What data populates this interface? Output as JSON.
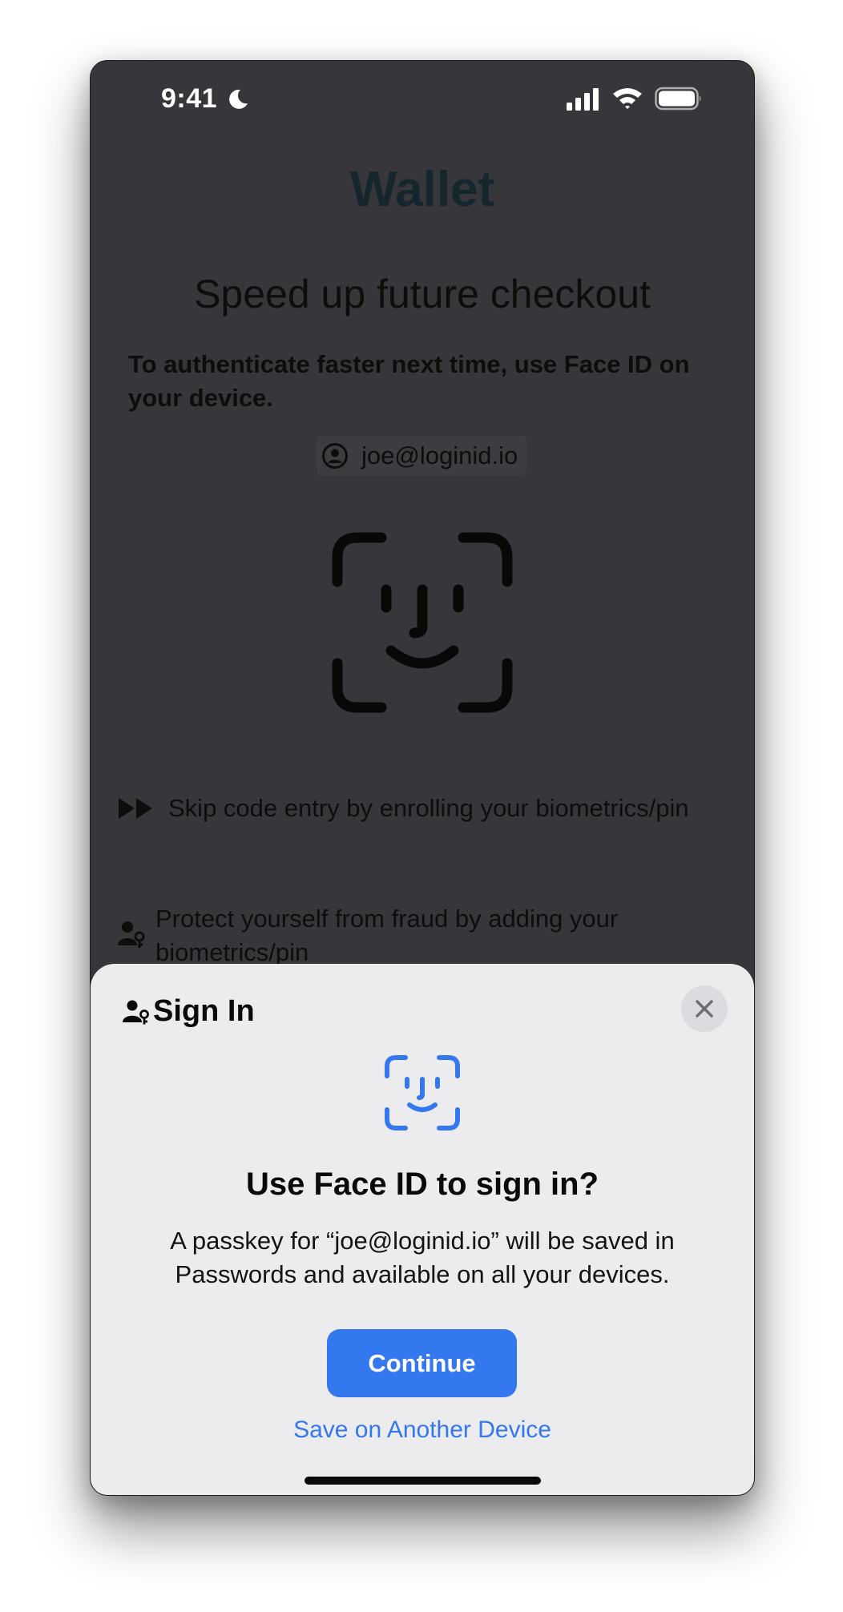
{
  "status_bar": {
    "time": "9:41"
  },
  "background": {
    "app_title": "Wallet",
    "headline": "Speed up future checkout",
    "lead_text": "To authenticate faster next time, use Face ID on your device.",
    "email": "joe@loginid.io",
    "features": [
      {
        "icon": "fast-forward-icon",
        "text": "Skip code entry by enrolling your biometrics/pin"
      },
      {
        "icon": "person-key-icon",
        "text": "Protect yourself from fraud by adding your biometrics/pin"
      }
    ]
  },
  "sheet": {
    "title": "Sign In",
    "icon": "faceid-icon",
    "heading": "Use Face ID to sign in?",
    "body": "A passkey for “joe@loginid.io” will be saved in Passwords and available on all your devices.",
    "continue_label": "Continue",
    "alt_link_label": "Save on Another Device"
  },
  "colors": {
    "accent": "#3478f0",
    "dim_background": "#37363a",
    "sheet_background": "#ececef"
  }
}
